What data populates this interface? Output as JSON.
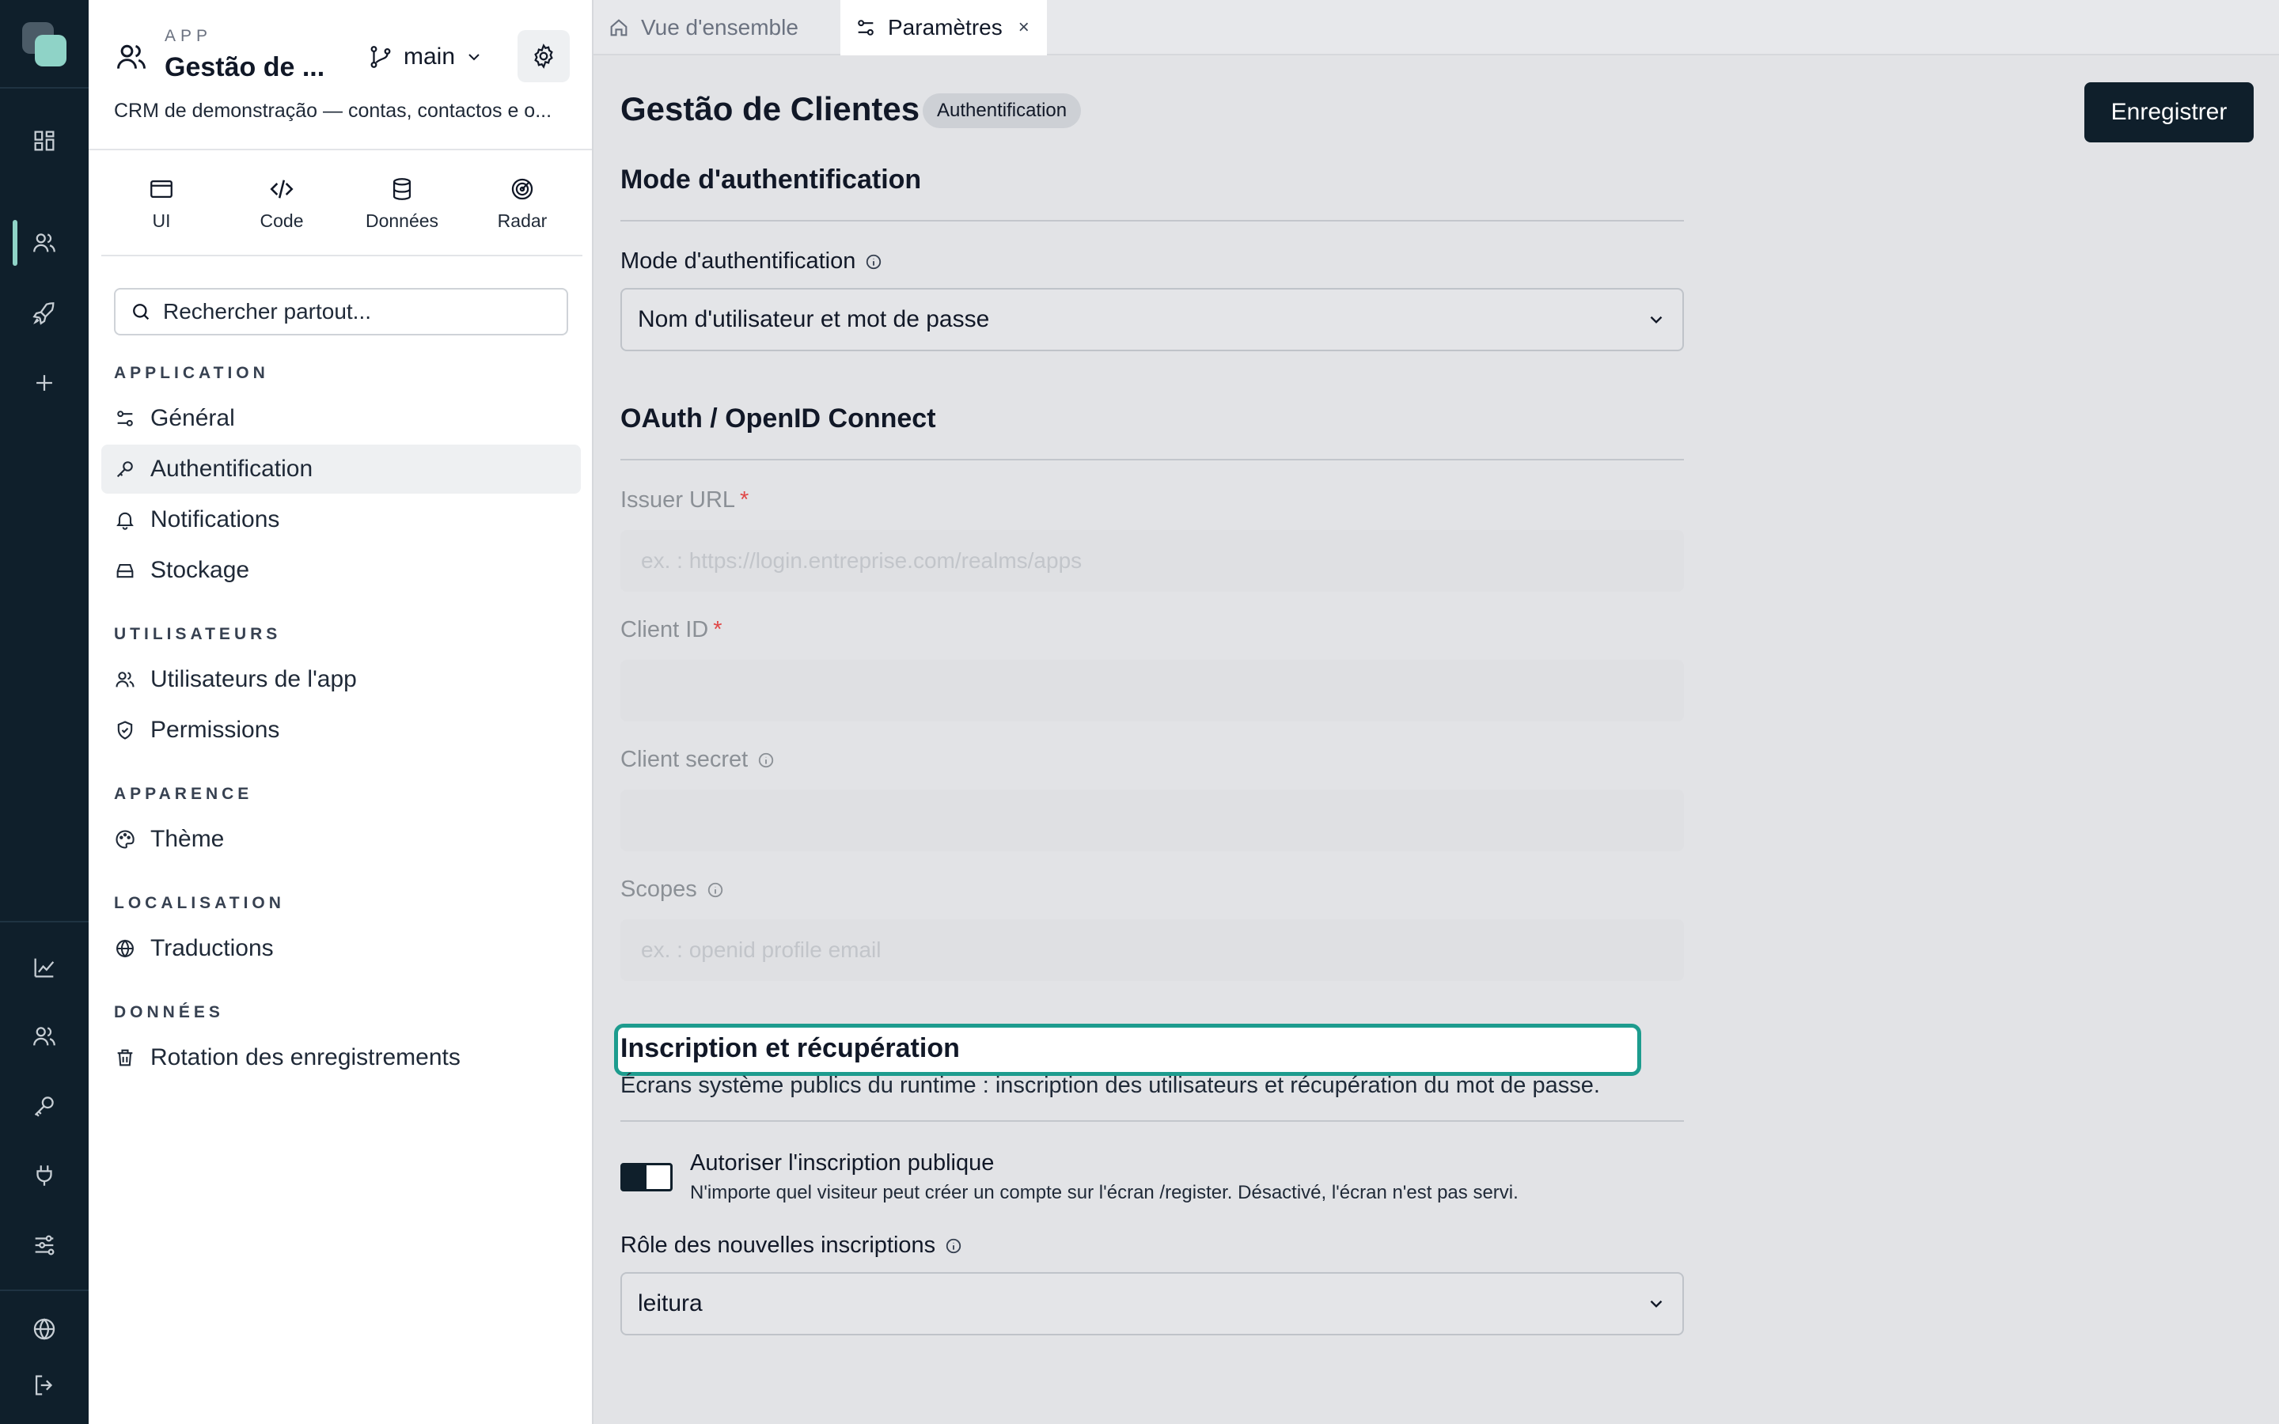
{
  "colors": {
    "rail_bg": "#0f1f2b",
    "accent": "#8fd3c7",
    "focus_ring": "#1d9c8e",
    "primary_button": "#0f1f2b",
    "required": "#e04848"
  },
  "rail": {
    "top_icons": [
      "grid-icon",
      "users-icon",
      "rocket-icon",
      "plus-icon"
    ],
    "bottom_icons": [
      "chart-icon",
      "users-icon",
      "key-icon",
      "plug-icon",
      "sliders-icon",
      "globe-icon",
      "logout-icon"
    ]
  },
  "app": {
    "kicker": "APP",
    "title": "Gestão de ...",
    "branch": "main",
    "description": "CRM de demonstração — contas, contactos e o..."
  },
  "tools": [
    {
      "label": "UI",
      "icon": "window-icon"
    },
    {
      "label": "Code",
      "icon": "code-icon"
    },
    {
      "label": "Données",
      "icon": "database-icon"
    },
    {
      "label": "Radar",
      "icon": "radar-icon"
    }
  ],
  "search": {
    "placeholder": "Rechercher partout..."
  },
  "nav": {
    "application": {
      "title": "APPLICATION",
      "items": [
        {
          "label": "Général",
          "icon": "sliders-icon"
        },
        {
          "label": "Authentification",
          "icon": "key-icon",
          "active": true
        },
        {
          "label": "Notifications",
          "icon": "bell-icon"
        },
        {
          "label": "Stockage",
          "icon": "storage-icon"
        }
      ]
    },
    "users": {
      "title": "UTILISATEURS",
      "items": [
        {
          "label": "Utilisateurs de l'app",
          "icon": "users-icon"
        },
        {
          "label": "Permissions",
          "icon": "shield-icon"
        }
      ]
    },
    "appearance": {
      "title": "APPARENCE",
      "items": [
        {
          "label": "Thème",
          "icon": "palette-icon"
        }
      ]
    },
    "localisation": {
      "title": "LOCALISATION",
      "items": [
        {
          "label": "Traductions",
          "icon": "globe-icon"
        }
      ]
    },
    "data": {
      "title": "DONNÉES",
      "items": [
        {
          "label": "Rotation des enregistrements",
          "icon": "trash-icon"
        }
      ]
    }
  },
  "tabs": [
    {
      "label": "Vue d'ensemble",
      "icon": "home-icon"
    },
    {
      "label": "Paramètres",
      "icon": "sliders-icon",
      "active": true,
      "close": "×"
    }
  ],
  "page": {
    "title": "Gestão de Clientes",
    "badge": "Authentification",
    "save_label": "Enregistrer"
  },
  "auth_mode": {
    "heading": "Mode d'authentification",
    "label": "Mode d'authentification",
    "value": "Nom d'utilisateur et mot de passe"
  },
  "oauth": {
    "heading": "OAuth / OpenID Connect",
    "issuer": {
      "label": "Issuer URL",
      "required": "*",
      "placeholder": "ex. : https://login.entreprise.com/realms/apps"
    },
    "client_id": {
      "label": "Client ID",
      "required": "*",
      "placeholder": ""
    },
    "client_secret": {
      "label": "Client secret",
      "placeholder": ""
    },
    "scopes": {
      "label": "Scopes",
      "placeholder": "ex. : openid profile email"
    }
  },
  "signup": {
    "heading": "Inscription et récupération",
    "description": "Écrans système publics du runtime : inscription des utilisateurs et récupération du mot de passe.",
    "toggle_title": "Autoriser l'inscription publique",
    "toggle_desc": "N'importe quel visiteur peut créer un compte sur l'écran /register. Désactivé, l'écran n'est pas servi.",
    "role_label": "Rôle des nouvelles inscriptions",
    "role_value": "leitura"
  }
}
